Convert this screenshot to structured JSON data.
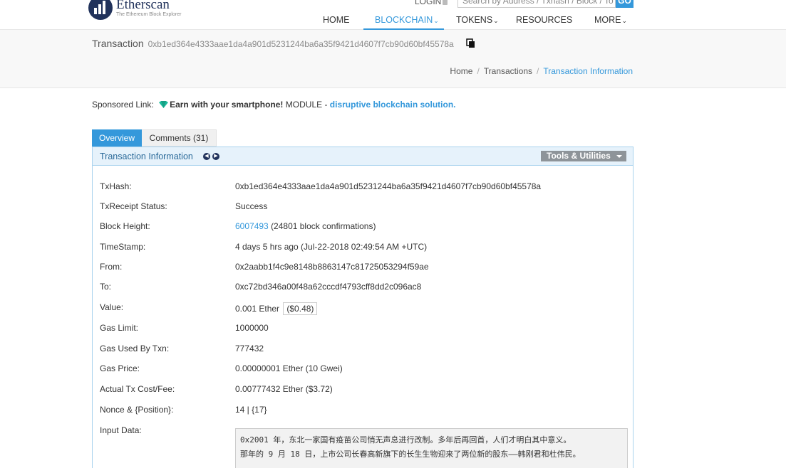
{
  "header": {
    "brand": "Etherscan",
    "tagline": "The Ethereum Block Explorer",
    "login_label": "LOGIN",
    "search_placeholder": "Search by Address / Txhash / Block / To",
    "search_button": "GO",
    "nav": [
      {
        "label": "HOME",
        "dropdown": false,
        "active": false
      },
      {
        "label": "BLOCKCHAIN",
        "dropdown": true,
        "active": true
      },
      {
        "label": "TOKENS",
        "dropdown": true,
        "active": false
      },
      {
        "label": "RESOURCES",
        "dropdown": false,
        "active": false
      },
      {
        "label": "MORE",
        "dropdown": true,
        "active": false
      }
    ]
  },
  "page": {
    "title": "Transaction",
    "hash": "0xb1ed364e4333aae1da4a901d5231244ba6a35f9421d4607f7cb90d60bf45578a",
    "breadcrumb": [
      "Home",
      "Transactions",
      "Transaction Information"
    ]
  },
  "sponsored": {
    "prefix": "Sponsored Link:",
    "headline": "Earn with your smartphone!",
    "middle": "MODULE -",
    "link_text": "disruptive blockchain solution."
  },
  "tabs": {
    "overview": "Overview",
    "comments": "Comments (31)"
  },
  "panel": {
    "title": "Transaction Information",
    "tools_label": "Tools & Utilities"
  },
  "details": {
    "txhash_label": "TxHash:",
    "txhash": "0xb1ed364e4333aae1da4a901d5231244ba6a35f9421d4607f7cb90d60bf45578a",
    "status_label": "TxReceipt Status:",
    "status": "Success",
    "block_label": "Block Height:",
    "block": "6007493",
    "block_confirmations": "(24801 block confirmations)",
    "timestamp_label": "TimeStamp:",
    "timestamp": "4 days 5 hrs ago (Jul-22-2018 02:49:54 AM +UTC)",
    "from_label": "From:",
    "from": "0x2aabb1f4c9e8148b8863147c81725053294f59ae",
    "to_label": "To:",
    "to": "0xc72bd346a00f48a62cccdf4793cff8dd2c096ac8",
    "value_label": "Value:",
    "value": "0.001 Ether",
    "value_usd": "($0.48)",
    "gas_limit_label": "Gas Limit:",
    "gas_limit": "1000000",
    "gas_used_label": "Gas Used By Txn:",
    "gas_used": "777432",
    "gas_price_label": "Gas Price:",
    "gas_price": "0.00000001 Ether (10 Gwei)",
    "fee_label": "Actual Tx Cost/Fee:",
    "fee": "0.00777432 Ether ($3.72)",
    "nonce_label": "Nonce & {Position}:",
    "nonce": "14 | {17}",
    "input_label": "Input Data:",
    "input_line1": "0x2001 年，东北一家国有疫苗公司悄无声息进行改制。多年后再回首，人们才明白其中意义。",
    "input_line2": "那年的 9 月 18 日，上市公司长春高新旗下的长生生物迎来了两位新的股东——韩刚君和杜伟民。"
  },
  "colors": {
    "accent": "#3498db",
    "brand_navy": "#21325b",
    "success": "#1e8c1e"
  }
}
